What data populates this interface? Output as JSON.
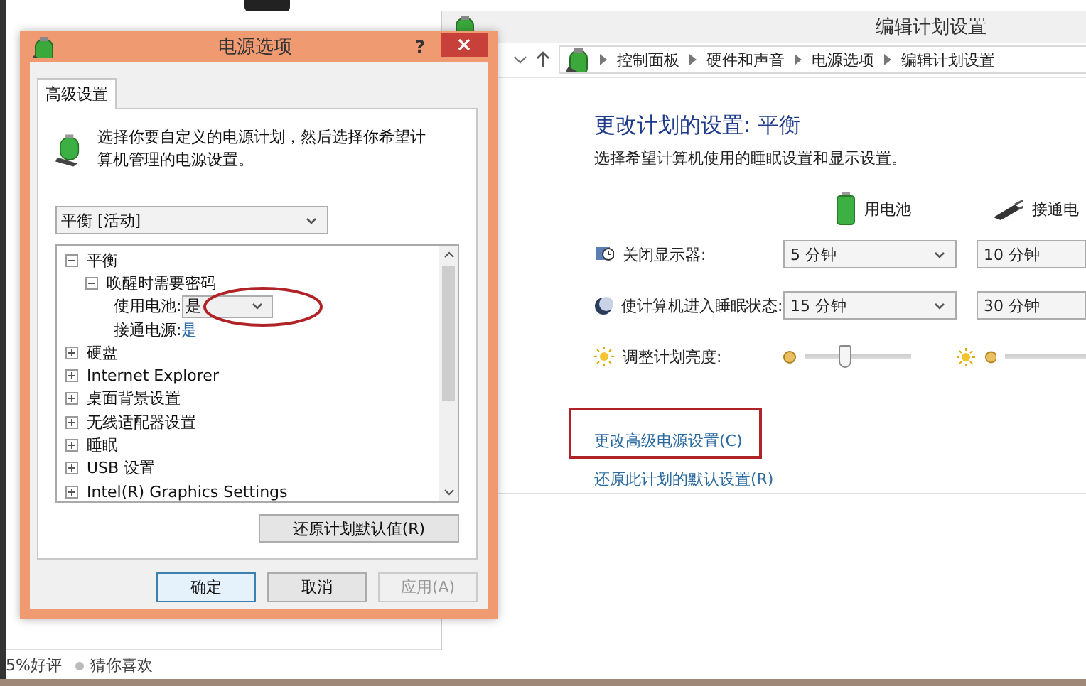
{
  "browser_page": {
    "rating": "5%好评",
    "recommend": "猜你喜欢"
  },
  "edit_plan_window": {
    "title": "编辑计划设置",
    "breadcrumb": [
      "控制面板",
      "硬件和声音",
      "电源选项",
      "编辑计划设置"
    ],
    "heading": "更改计划的设置: 平衡",
    "subtitle": "选择希望计算机使用的睡眠设置和显示设置。",
    "columns": [
      {
        "kind": "battery",
        "label": "用电池"
      },
      {
        "kind": "plug",
        "label": "接通电"
      }
    ],
    "settings": [
      {
        "kind": "dropdown",
        "label": "关闭显示器:",
        "values": [
          "5 分钟",
          "10 分钟"
        ]
      },
      {
        "kind": "dropdown",
        "label": "使计算机进入睡眠状态:",
        "values": [
          "15 分钟",
          "30 分钟"
        ]
      },
      {
        "kind": "slider",
        "label": "调整计划亮度:",
        "level": 0.38
      }
    ],
    "links": [
      {
        "label": "更改高级电源设置(C)",
        "highlighted": true
      },
      {
        "label": "还原此计划的默认设置(R)",
        "highlighted": false
      }
    ]
  },
  "dialog": {
    "title": "电源选项",
    "help": "?",
    "tabs": [
      {
        "label": "高级设置",
        "selected": true
      }
    ],
    "description": "选择你要自定义的电源计划，然后选择你希望计算机管理的电源设置。",
    "plan": "平衡 [活动]",
    "tree": [
      {
        "label": "平衡",
        "expanded": true,
        "children": [
          {
            "label": "唤醒时需要密码",
            "expanded": true,
            "children": [
              {
                "kind": "dropdown",
                "label": "使用电池:",
                "value": "是",
                "highlighted": true
              },
              {
                "kind": "value",
                "label": "接通电源:",
                "value": "是"
              }
            ]
          }
        ]
      },
      {
        "label": "硬盘",
        "expanded": false
      },
      {
        "label": "Internet Explorer",
        "expanded": false
      },
      {
        "label": "桌面背景设置",
        "expanded": false
      },
      {
        "label": "无线适配器设置",
        "expanded": false
      },
      {
        "label": "睡眠",
        "expanded": false
      },
      {
        "label": "USB 设置",
        "expanded": false
      },
      {
        "label": "Intel(R) Graphics Settings",
        "expanded": false
      }
    ],
    "restore_button": "还原计划默认值(R)",
    "buttons": [
      {
        "label": "确定",
        "kind": "default",
        "disabled": false
      },
      {
        "label": "取消",
        "kind": "normal",
        "disabled": false
      },
      {
        "label": "应用(A)",
        "kind": "normal",
        "disabled": true
      }
    ]
  }
}
